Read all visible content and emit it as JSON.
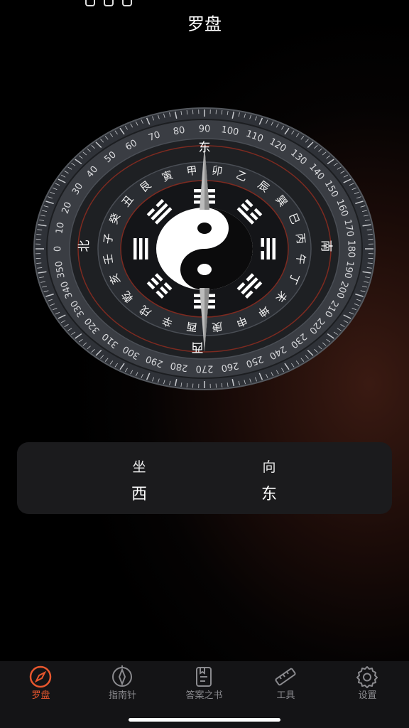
{
  "page_title": "罗盘",
  "compass": {
    "degree_labels": [
      "0",
      "10",
      "20",
      "30",
      "40",
      "50",
      "60",
      "70",
      "80",
      "90",
      "100",
      "110",
      "120",
      "130",
      "140",
      "150",
      "160",
      "170",
      "180",
      "190",
      "200",
      "210",
      "220",
      "230",
      "240",
      "250",
      "260",
      "270",
      "280",
      "290",
      "300",
      "310",
      "320",
      "330",
      "340",
      "350"
    ],
    "mountain_labels": [
      "子",
      "癸",
      "丑",
      "艮",
      "寅",
      "甲",
      "卯",
      "乙",
      "辰",
      "巽",
      "巳",
      "丙",
      "午",
      "丁",
      "未",
      "坤",
      "申",
      "庚",
      "酉",
      "辛",
      "戌",
      "乾",
      "亥",
      "壬"
    ],
    "directions": {
      "north": "北",
      "east": "东",
      "south": "南",
      "west": "西"
    },
    "colors": {
      "ring": "#3b3f46",
      "ring_dark": "#23262b",
      "red_ring": "#7d2a20",
      "needle": "#a6a6a6"
    }
  },
  "info": {
    "sit_label": "坐",
    "sit_value": "西",
    "face_label": "向",
    "face_value": "东"
  },
  "tabs": [
    {
      "label": "罗盘",
      "icon": "compass-icon",
      "active": true
    },
    {
      "label": "指南针",
      "icon": "navigation-icon",
      "active": false
    },
    {
      "label": "答案之书",
      "icon": "book-icon",
      "active": false
    },
    {
      "label": "工具",
      "icon": "ruler-icon",
      "active": false
    },
    {
      "label": "设置",
      "icon": "gear-icon",
      "active": false
    }
  ],
  "accent_color": "#e8572e"
}
